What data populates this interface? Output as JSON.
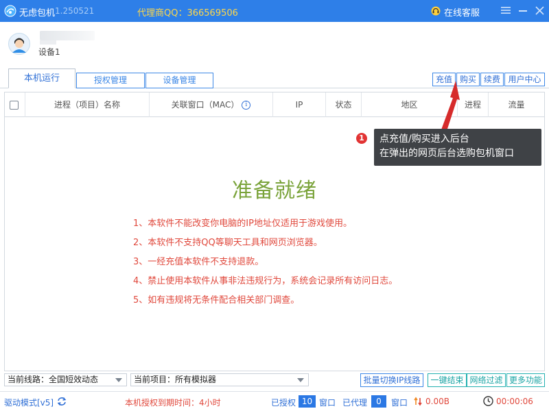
{
  "titlebar": {
    "app_name": "无虑包机",
    "version": "1.250521",
    "agent_qq": "代理商QQ：366569506",
    "service_label": "在线客服"
  },
  "device": {
    "name": "设备1"
  },
  "tabs": [
    {
      "label": "本机运行",
      "active": true
    },
    {
      "label": "授权管理",
      "active": false
    },
    {
      "label": "设备管理",
      "active": false
    }
  ],
  "top_buttons": {
    "recharge": "充值",
    "buy": "购买",
    "renew": "续费",
    "user_center": "用户中心"
  },
  "table": {
    "columns": [
      "进程（项目）名称",
      "关联窗口（MAC）",
      "IP",
      "状态",
      "地区",
      "进程",
      "流量"
    ]
  },
  "main": {
    "ready_text": "准备就绪",
    "notices": [
      "1、本软件不能改变你电脑的IP地址仅适用于游戏使用。",
      "2、本软件不支持QQ等聊天工具和网页浏览器。",
      "3、一经充值本软件不支持退款。",
      "4、禁止使用本软件从事非法违规行为，系统会记录所有访问日志。",
      "5、如有违规将无条件配合相关部门调查。"
    ]
  },
  "tooltip": {
    "badge": "1",
    "line1": "点充值/购买进入后台",
    "line2": "在弹出的网页后台选购包机窗口"
  },
  "bottom": {
    "line_select": "当前线路：全国短效动态",
    "project_select": "当前项目：所有模拟器",
    "batch_switch": "批量切换IP线路",
    "end_all": "一键结束",
    "net_filter": "网络过滤",
    "more": "更多功能"
  },
  "status": {
    "driver_mode": "驱动模式[v5]",
    "expire": "本机授权到期时间：4小时",
    "authorized_label": "已授权",
    "authorized_count": "10",
    "window_label_1": "窗口",
    "proxied_label": "已代理",
    "proxied_count": "0",
    "window_label_2": "窗口",
    "speed": "0.00B",
    "timer": "00:00:06"
  },
  "colors": {
    "titlebar": "#2e7fe8",
    "accent": "#2f6fd6",
    "warning": "#e0483c",
    "ready": "#7aa33a"
  }
}
